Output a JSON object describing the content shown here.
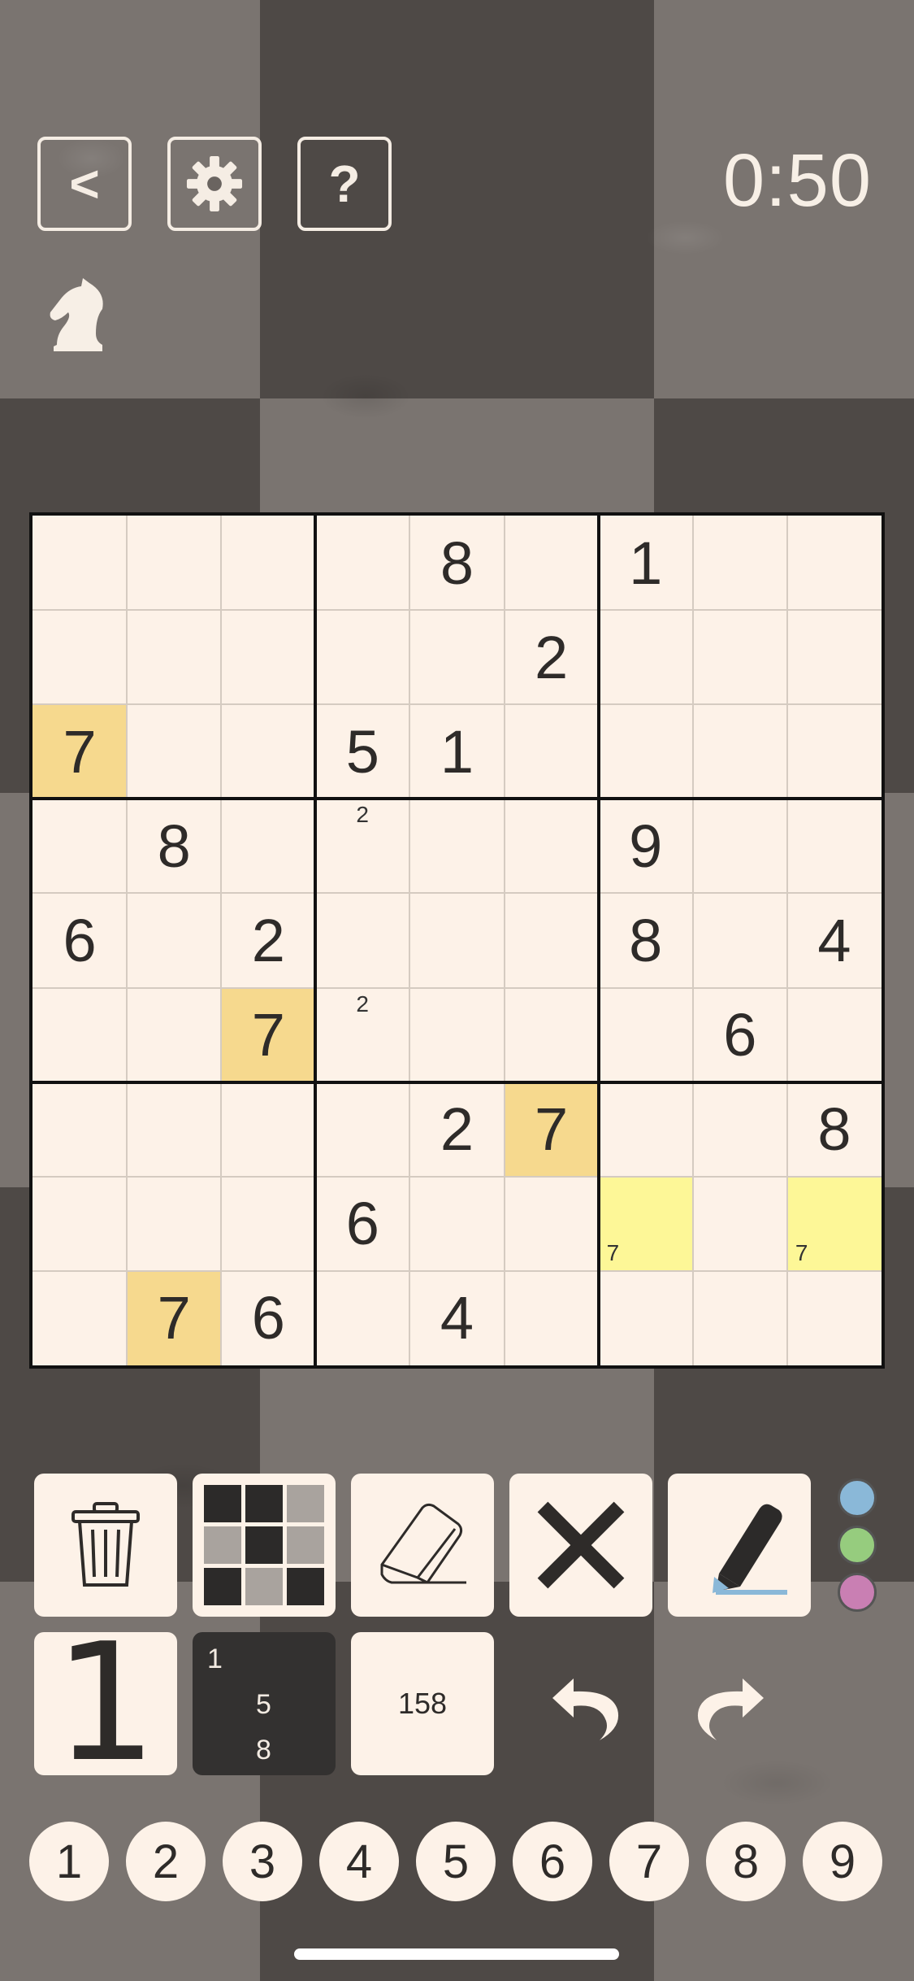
{
  "header": {
    "back_label": "<",
    "help_label": "?",
    "timer": "0:50"
  },
  "icons": {
    "settings": "gear-icon",
    "mode": "chess-knight-icon",
    "trash": "trash-icon",
    "color_mode": "color-grid-icon",
    "eraser": "eraser-icon",
    "cross": "cross-icon",
    "pen": "pen-icon",
    "undo": "undo-icon",
    "redo": "redo-icon"
  },
  "board": {
    "values": [
      [
        "",
        "",
        "",
        "",
        "8",
        "",
        "1",
        "",
        ""
      ],
      [
        "",
        "",
        "",
        "",
        "",
        "2",
        "",
        "",
        ""
      ],
      [
        "7",
        "",
        "",
        "5",
        "1",
        "",
        "",
        "",
        ""
      ],
      [
        "",
        "8",
        "",
        "",
        "",
        "",
        "9",
        "",
        ""
      ],
      [
        "6",
        "",
        "2",
        "",
        "",
        "",
        "8",
        "",
        "4"
      ],
      [
        "",
        "",
        "7",
        "",
        "",
        "",
        "",
        "6",
        ""
      ],
      [
        "",
        "",
        "",
        "",
        "2",
        "7",
        "",
        "",
        "8"
      ],
      [
        "",
        "",
        "",
        "6",
        "",
        "",
        "",
        "",
        ""
      ],
      [
        "",
        "7",
        "6",
        "",
        "4",
        "",
        "",
        "",
        ""
      ]
    ],
    "highlighted_cells": [
      [
        2,
        0
      ],
      [
        5,
        2
      ],
      [
        6,
        5
      ],
      [
        8,
        1
      ]
    ],
    "selected_cells": [
      [
        7,
        6
      ],
      [
        7,
        8
      ]
    ],
    "corner_notes": [
      {
        "row": 3,
        "col": 3,
        "pos": "top",
        "text": "2"
      },
      {
        "row": 5,
        "col": 3,
        "pos": "top",
        "text": "2"
      },
      {
        "row": 7,
        "col": 6,
        "pos": "bottom-left",
        "text": "7"
      },
      {
        "row": 7,
        "col": 8,
        "pos": "bottom-left",
        "text": "7"
      }
    ]
  },
  "colors": {
    "highlight": "#f6d98e",
    "selection": "#fdf797",
    "cell_bg": "#fdf2e8",
    "palette": [
      "#8ab8d8",
      "#96cc7e",
      "#c97fb3"
    ]
  },
  "modes": {
    "big_digit": "1",
    "corner_marks": [
      "1",
      "5",
      "8"
    ],
    "center_marks": "158"
  },
  "keypad": [
    "1",
    "2",
    "3",
    "4",
    "5",
    "6",
    "7",
    "8",
    "9"
  ]
}
